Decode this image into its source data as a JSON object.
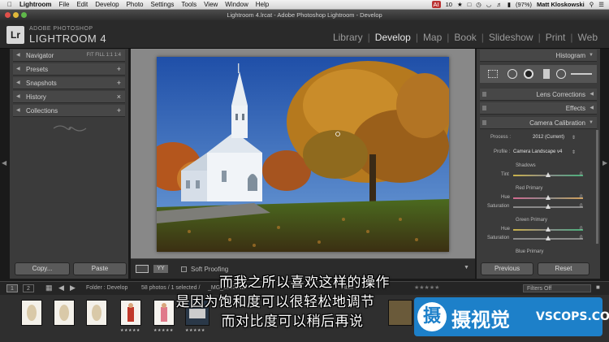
{
  "mac_menu": {
    "app": "Lightroom",
    "items": [
      "File",
      "Edit",
      "Develop",
      "Photo",
      "Settings",
      "Tools",
      "View",
      "Window",
      "Help"
    ],
    "ai_badge": "AI",
    "ai_count": "10",
    "battery": "(97%)",
    "user": "Matt Kloskowski"
  },
  "window": {
    "title": "Lightroom 4.lrcat - Adobe Photoshop Lightroom - Develop"
  },
  "identity": {
    "logo": "Lr",
    "adobe_line": "ADOBE PHOTOSHOP",
    "product": "LIGHTROOM 4"
  },
  "modules": [
    {
      "label": "Library"
    },
    {
      "label": "Develop"
    },
    {
      "label": "Map"
    },
    {
      "label": "Book"
    },
    {
      "label": "Slideshow"
    },
    {
      "label": "Print"
    },
    {
      "label": "Web"
    }
  ],
  "left_panel": {
    "navigator": "Navigator",
    "nav_options": "FIT  FILL  1:1  1:4",
    "presets": "Presets",
    "snapshots": "Snapshots",
    "history": "History",
    "collections": "Collections",
    "add_symbol": "+",
    "clear_symbol": "×",
    "copy": "Copy...",
    "paste": "Paste"
  },
  "toolbar": {
    "soft_proofing": "Soft Proofing"
  },
  "right_panel": {
    "histogram": "Histogram",
    "lens_corrections": "Lens Corrections",
    "effects": "Effects",
    "camera_calibration": "Camera Calibration",
    "process_label": "Process :",
    "process_value": "2012 (Current)",
    "profile_label": "Profile :",
    "profile_value": "Camera Landscape v4",
    "shadows": "Shadows",
    "tint": "Tint",
    "red_primary": "Red Primary",
    "green_primary": "Green Primary",
    "blue_primary": "Blue Primary",
    "hue": "Hue",
    "saturation": "Saturation",
    "zero": "0",
    "previous": "Previous",
    "reset": "Reset"
  },
  "filmstrip": {
    "page1": "1",
    "page2": "2",
    "folder": "Folder : Develop",
    "count": "58 photos / 1 selected /",
    "filename": "_MG_8383.NEF",
    "filter_label": "Filter :",
    "filters": "Filters Off",
    "stars": "★★★★★"
  },
  "subtitles": [
    "而我之所以喜欢这样的操作",
    "是因为饱和度可以很轻松地调节",
    "而对比度可以稍后再说"
  ],
  "watermark": {
    "logo": "摄",
    "name": "摄视觉",
    "url": "VSCOPS.COM"
  }
}
